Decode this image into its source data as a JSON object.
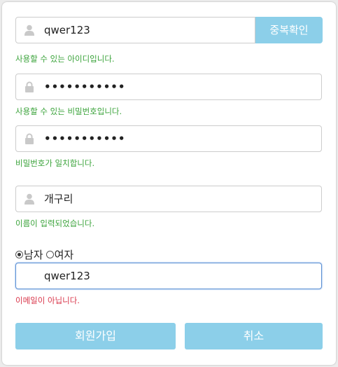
{
  "form": {
    "userid": {
      "value": "qwer123",
      "icon": "user-icon"
    },
    "dup_check_label": "중복확인",
    "userid_msg": "사용할 수 있는 아이디입니다.",
    "password": {
      "value": "•••••••••••",
      "icon": "lock-icon"
    },
    "password_msg": "사용할 수 있는 비밀번호입니다.",
    "password_confirm": {
      "value": "•••••••••••",
      "icon": "lock-icon"
    },
    "password_confirm_msg": "비밀번호가 일치합니다.",
    "name": {
      "value": "개구리",
      "icon": "user-icon"
    },
    "name_msg": "이름이 입력되었습니다.",
    "gender": {
      "male_label": "남자",
      "female_label": "여자",
      "selected": "male"
    },
    "email": {
      "value": "qwer123"
    },
    "email_msg": "이메일이 아닙니다.",
    "signup_label": "회원가입",
    "cancel_label": "취소"
  },
  "colors": {
    "accent": "#8ccfe9",
    "ok": "#3aa33a",
    "error": "#d9364a",
    "focus": "#5b8fd3"
  }
}
